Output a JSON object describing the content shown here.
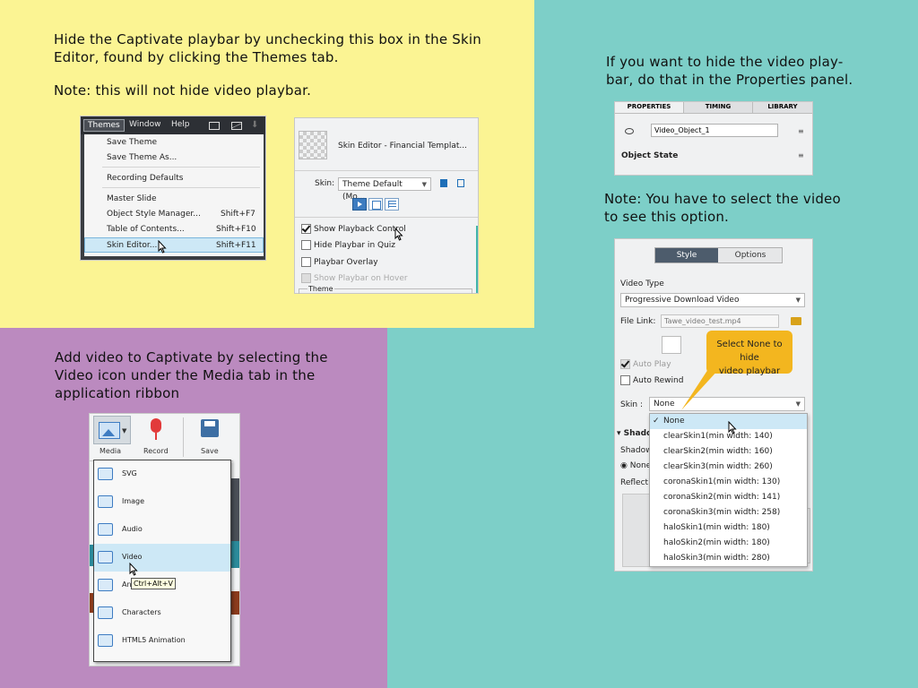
{
  "notes": {
    "hide_playbar": [
      "Hide the Captivate playbar by unchecking this box in the Skin",
      "Editor, found by clicking the Themes tab."
    ],
    "not_video": "Note: this will not hide video playbar.",
    "hide_video": [
      "If you want to hide the video play-",
      "bar, do that in the Properties panel."
    ],
    "select_video": [
      "Note: You have to select the video",
      "to see this option."
    ],
    "add_video": [
      "Add video to Captivate by selecting the",
      "Video icon under the Media tab in the",
      "application ribbon"
    ]
  },
  "themes_menu": {
    "menubar": [
      "Themes",
      "Window",
      "Help"
    ],
    "items": [
      {
        "label": "Save Theme",
        "shortcut": ""
      },
      {
        "label": "Save Theme As...",
        "shortcut": ""
      },
      {
        "label": "Recording Defaults",
        "shortcut": ""
      },
      {
        "label": "Master Slide",
        "shortcut": ""
      },
      {
        "label": "Object Style Manager...",
        "shortcut": "Shift+F7"
      },
      {
        "label": "Table of Contents...",
        "shortcut": "Shift+F10"
      },
      {
        "label": "Skin Editor...",
        "shortcut": "Shift+F11"
      }
    ]
  },
  "skin_editor": {
    "title": "Skin Editor - Financial Templat...",
    "skin_label": "Skin:",
    "skin_value": "Theme Default (Mo...",
    "options": [
      {
        "label": "Show Playback Control",
        "checked": true,
        "disabled": false
      },
      {
        "label": "Hide Playbar in Quiz",
        "checked": false,
        "disabled": false
      },
      {
        "label": "Playbar Overlay",
        "checked": false,
        "disabled": false
      },
      {
        "label": "Show Playbar on Hover",
        "checked": false,
        "disabled": true
      }
    ],
    "group_label": "Theme"
  },
  "properties_panel": {
    "tabs": [
      "PROPERTIES",
      "TIMING",
      "LIBRARY"
    ],
    "name_value": "Video_Object_1",
    "object_state": "Object State"
  },
  "video_panel": {
    "tabs": [
      "Style",
      "Options"
    ],
    "video_type_label": "Video Type",
    "video_type_value": "Progressive Download Video",
    "file_link_label": "File Link:",
    "file_link_value": "Tawe_video_test.mp4",
    "auto_play": "Auto Play",
    "auto_rewind": "Auto Rewind",
    "skin_label": "Skin :",
    "skin_value": "None",
    "callout": [
      "Select None to hide",
      "video playbar"
    ],
    "truncated_labels": [
      "Shado",
      "Shadow",
      "None",
      "Reflectio"
    ],
    "skin_options": [
      "None",
      "clearSkin1(min width: 140)",
      "clearSkin2(min width: 160)",
      "clearSkin3(min width: 260)",
      "coronaSkin1(min width: 130)",
      "coronaSkin2(min width: 141)",
      "coronaSkin3(min width: 258)",
      "haloSkin1(min width: 180)",
      "haloSkin2(min width: 180)",
      "haloSkin3(min width: 280)"
    ]
  },
  "media_menu": {
    "ribbon": [
      "Media",
      "Record",
      "Save"
    ],
    "items": [
      "SVG",
      "Image",
      "Audio",
      "Video",
      "Animation",
      "Characters",
      "HTML5 Animation"
    ],
    "tooltip": "Ctrl+Alt+V",
    "anim_visible": "An"
  },
  "colors": {
    "yellow": "#fbf493",
    "teal": "#7dcfc8",
    "purple": "#bb8abf",
    "callout": "#f3b61f",
    "highlight": "#cde8f6"
  }
}
